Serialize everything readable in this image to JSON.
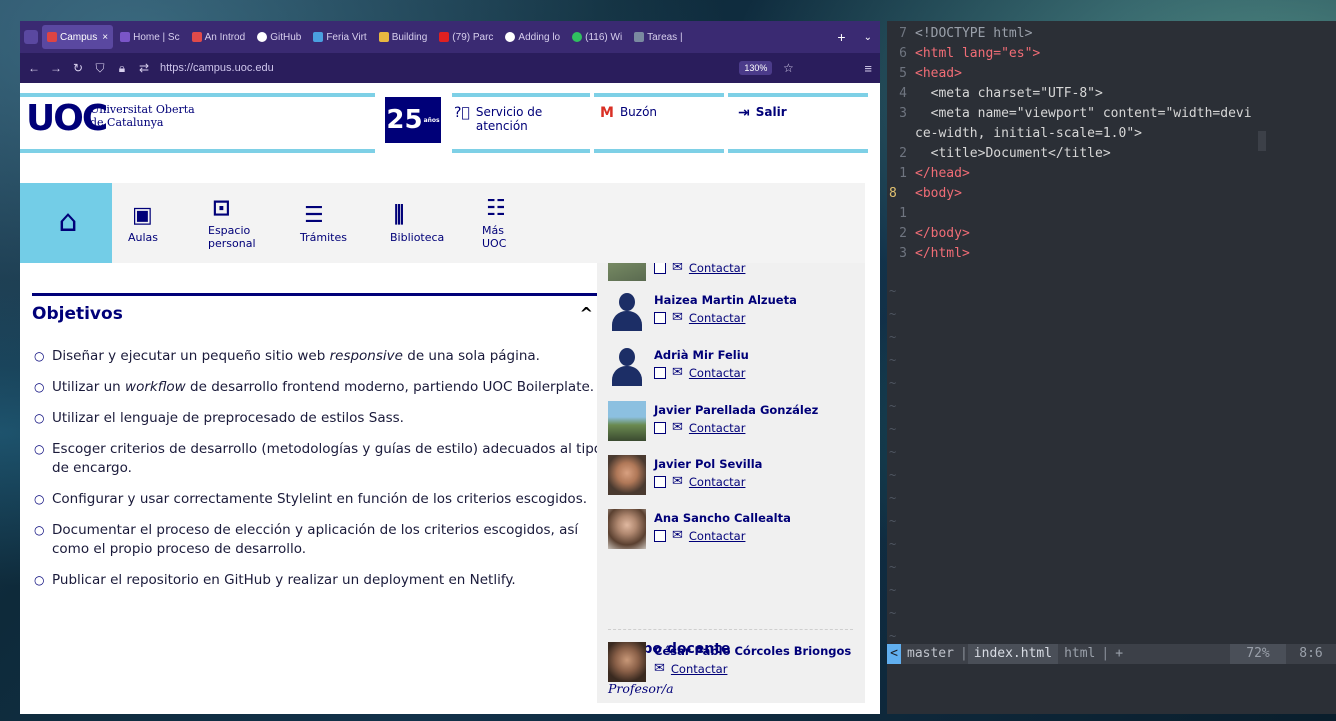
{
  "browser": {
    "tabs": [
      {
        "label": "Campus",
        "color": "#d44",
        "active": true
      },
      {
        "label": "Home | Sc",
        "color": "#7a55c8",
        "active": false
      },
      {
        "label": "An Introd",
        "color": "#e04a4a",
        "active": false
      },
      {
        "label": "GitHub",
        "color": "#ffffff",
        "active": false
      },
      {
        "label": "Feria Virt",
        "color": "#4aa0e0",
        "active": false
      },
      {
        "label": "Building",
        "color": "#e8b840",
        "active": false
      },
      {
        "label": "(79) Parc",
        "color": "#e02020",
        "active": false
      },
      {
        "label": "Adding lo",
        "color": "#ffffff",
        "active": false
      },
      {
        "label": "(116) Wi",
        "color": "#30c060",
        "active": false
      },
      {
        "label": "Tareas |",
        "color": "#7a8aa0",
        "active": false
      }
    ],
    "new_tab": "+",
    "url": "https://campus.uoc.edu",
    "zoom": "130%",
    "star": "☆",
    "menu": "≡"
  },
  "header": {
    "logo_mark": "UOC",
    "logo_line1": "Universitat Oberta",
    "logo_line2": "de Catalunya",
    "anniv_number": "25",
    "anniv_suffix": "años",
    "servicio": "Servicio de atención",
    "buzon": "Buzón",
    "salir": "Salir"
  },
  "nav": {
    "home_icon": "⌂",
    "items": [
      {
        "label": "Aulas",
        "icon": "▣"
      },
      {
        "label": "Espacio personal",
        "icon": "⊡"
      },
      {
        "label": "Trámites",
        "icon": "☰"
      },
      {
        "label": "Biblioteca",
        "icon": "⫼"
      },
      {
        "label": "Más UOC",
        "icon": "☷"
      }
    ]
  },
  "objetivos": {
    "title": "Objetivos",
    "chevron": "^",
    "items": [
      {
        "before": "Diseñar y ejecutar un pequeño sitio web ",
        "em": "responsive",
        "after": " de una sola página."
      },
      {
        "before": "Utilizar un ",
        "em": "workflow",
        "after": " de desarrollo frontend moderno, partiendo UOC Boilerplate."
      },
      {
        "before": "Utilizar el lenguaje de preprocesado de estilos Sass.",
        "em": "",
        "after": ""
      },
      {
        "before": "Escoger criterios de desarrollo (metodologías y guías de estilo) adecuados al tipo de encargo.",
        "em": "",
        "after": ""
      },
      {
        "before": "Configurar y usar correctamente Stylelint en función de los criterios escogidos.",
        "em": "",
        "after": ""
      },
      {
        "before": "Documentar el proceso de elección y aplicación de los criterios escogidos, así como el propio proceso de desarrollo.",
        "em": "",
        "after": ""
      },
      {
        "before": "Publicar el repositorio en GitHub y realizar un deployment en Netlify.",
        "em": "",
        "after": ""
      }
    ],
    "bullet": "○"
  },
  "sidebar": {
    "contact_label": "Contactar",
    "people": [
      {
        "name": "",
        "avatar": "photo"
      },
      {
        "name": "Haizea Martin Alzueta",
        "avatar": "silhouette"
      },
      {
        "name": "Adrià Mir Feliu",
        "avatar": "silhouette"
      },
      {
        "name": "Javier Parellada González",
        "avatar": "photo"
      },
      {
        "name": "Javier Pol Sevilla",
        "avatar": "photo"
      },
      {
        "name": "Ana Sancho Callealta",
        "avatar": "photo"
      }
    ],
    "equipo_docente": "Equipo docente",
    "profesor_label": "Profesor/a",
    "teacher": {
      "name": "César Pablo Córcoles Briongos",
      "contact": "Contactar"
    }
  },
  "editor": {
    "status": {
      "mode": "<",
      "branch": "master",
      "file": "index.html",
      "filetype": "html",
      "modified": "+",
      "percent": "72%",
      "position": "8:6"
    },
    "line_numbers": [
      "7",
      "6",
      "5",
      "4",
      "3",
      "",
      "2",
      "1",
      "8",
      "1",
      "2",
      "3"
    ],
    "code_lines": [
      "<!DOCTYPE html>",
      "<html lang=\"es\">",
      "<head>",
      "  <meta charset=\"UTF-8\">",
      "  <meta name=\"viewport\" content=\"width=devi",
      "ce-width, initial-scale=1.0\">",
      "  <title>Document</title>",
      "</head>",
      "<body>",
      "",
      "</body>",
      "</html>"
    ]
  }
}
